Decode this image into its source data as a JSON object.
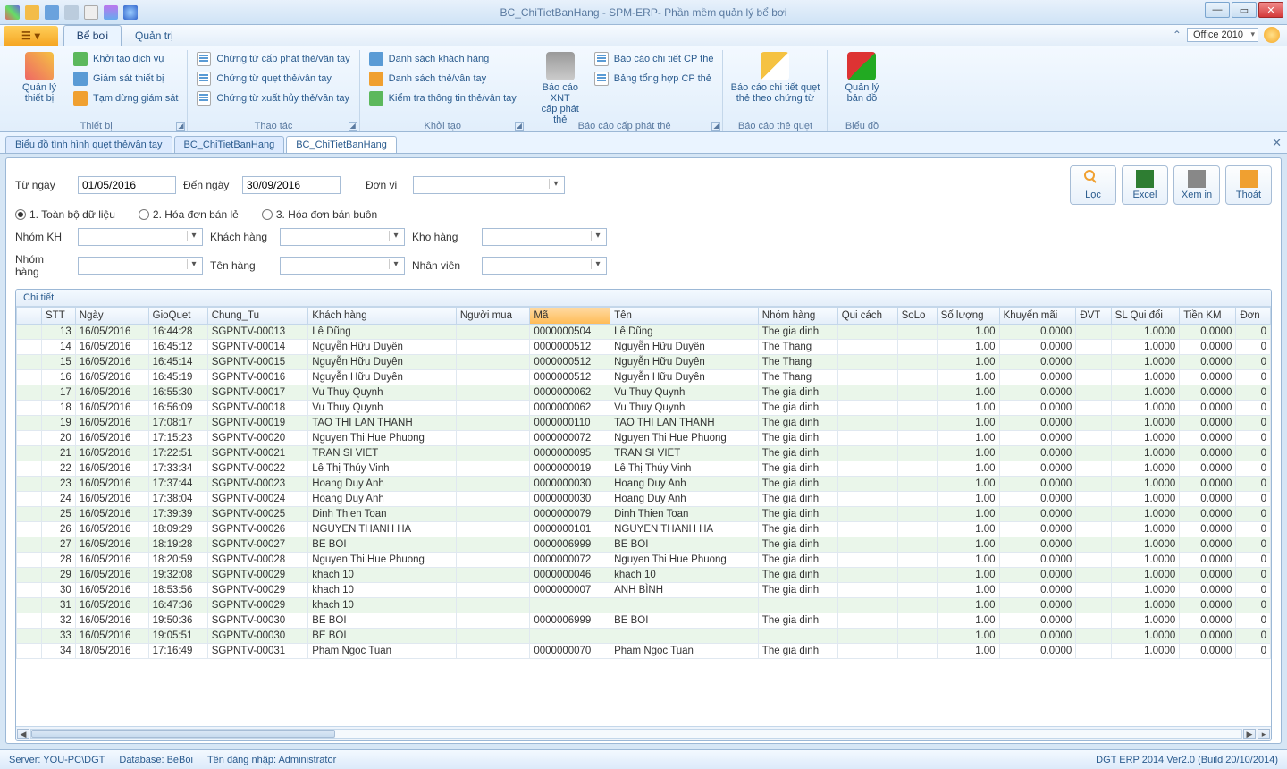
{
  "window": {
    "title": "BC_ChiTietBanHang - SPM-ERP- Phần mềm quản lý bể bơi"
  },
  "theme": "Office 2010",
  "ribbonTabs": {
    "file": "",
    "t1": "Bể bơi",
    "t2": "Quản trị"
  },
  "ribbon": {
    "g1": {
      "label": "Thiết bị",
      "large": "Quản lý\nthiết bị",
      "a": "Khởi tạo dịch vụ",
      "b": "Giám sát thiết bị",
      "c": "Tạm dừng giám sát"
    },
    "g2": {
      "label": "Thao tác",
      "a": "Chứng từ cấp phát thẻ/vân tay",
      "b": "Chứng từ quẹt thẻ/vân tay",
      "c": "Chứng từ xuất hủy thẻ/vân tay"
    },
    "g3": {
      "label": "Khởi tạo",
      "a": "Danh sách khách hàng",
      "b": "Danh sách thẻ/vân tay",
      "c": "Kiểm tra thông tin thẻ/vân tay"
    },
    "g4": {
      "label": "Báo cáo cấp phát thẻ",
      "large": "Báo cáo XNT\ncấp phát thẻ",
      "a": "Báo cáo chi tiết CP thẻ",
      "b": "Bảng tổng hợp CP thẻ"
    },
    "g5": {
      "label": "Báo cáo thẻ quẹt",
      "large": "Báo cáo chi tiết quẹt\nthẻ theo chứng từ"
    },
    "g6": {
      "label": "Biểu đồ",
      "large": "Quản lý\nbản đồ"
    }
  },
  "subtabs": {
    "a": "Biểu đồ tình hình quẹt thẻ/vân tay",
    "b": "BC_ChiTietBanHang",
    "c": "BC_ChiTietBanHang"
  },
  "filters": {
    "fromLabel": "Từ ngày",
    "from": "01/05/2016",
    "toLabel": "Đến ngày",
    "to": "30/09/2016",
    "donviLabel": "Đơn vị",
    "donvi": "",
    "r1": "1. Toàn bộ dữ liệu",
    "r2": "2. Hóa đơn bán lẻ",
    "r3": "3. Hóa đơn bán buôn",
    "nhomKHL": "Nhóm KH",
    "khachHangL": "Khách hàng",
    "khoHangL": "Kho hàng",
    "nhomHangL": "Nhóm hàng",
    "tenHangL": "Tên hàng",
    "nhanVienL": "Nhân viên"
  },
  "actions": {
    "loc": "Lọc",
    "excel": "Excel",
    "xemin": "Xem in",
    "thoat": "Thoát"
  },
  "grid": {
    "title": "Chi tiết",
    "cols": [
      "",
      "STT",
      "Ngày",
      "GioQuet",
      "Chung_Tu",
      "Khách hàng",
      "Người mua",
      "Mã",
      "Tên",
      "Nhóm hàng",
      "Qui cách",
      "SoLo",
      "Số lượng",
      "Khuyến mãi",
      "ĐVT",
      "SL Qui đổi",
      "Tiền KM",
      "Đơn"
    ],
    "rows": [
      {
        "stt": 13,
        "ngay": "16/05/2016",
        "gio": "16:44:28",
        "ct": "SGPNTV-00013",
        "kh": "Lê Dũng",
        "ma": "0000000504",
        "ten": "Lê Dũng",
        "nh": "The gia dinh"
      },
      {
        "stt": 14,
        "ngay": "16/05/2016",
        "gio": "16:45:12",
        "ct": "SGPNTV-00014",
        "kh": "Nguyễn Hữu Duyên",
        "ma": "0000000512",
        "ten": "Nguyễn Hữu Duyên",
        "nh": "The Thang"
      },
      {
        "stt": 15,
        "ngay": "16/05/2016",
        "gio": "16:45:14",
        "ct": "SGPNTV-00015",
        "kh": "Nguyễn Hữu Duyên",
        "ma": "0000000512",
        "ten": "Nguyễn Hữu Duyên",
        "nh": "The Thang"
      },
      {
        "stt": 16,
        "ngay": "16/05/2016",
        "gio": "16:45:19",
        "ct": "SGPNTV-00016",
        "kh": "Nguyễn Hữu Duyên",
        "ma": "0000000512",
        "ten": "Nguyễn Hữu Duyên",
        "nh": "The Thang"
      },
      {
        "stt": 17,
        "ngay": "16/05/2016",
        "gio": "16:55:30",
        "ct": "SGPNTV-00017",
        "kh": "Vu Thuy Quynh",
        "ma": "0000000062",
        "ten": "Vu Thuy Quynh",
        "nh": "The gia dinh"
      },
      {
        "stt": 18,
        "ngay": "16/05/2016",
        "gio": "16:56:09",
        "ct": "SGPNTV-00018",
        "kh": "Vu Thuy Quynh",
        "ma": "0000000062",
        "ten": "Vu Thuy Quynh",
        "nh": "The gia dinh"
      },
      {
        "stt": 19,
        "ngay": "16/05/2016",
        "gio": "17:08:17",
        "ct": "SGPNTV-00019",
        "kh": "TAO THI LAN THANH",
        "ma": "0000000110",
        "ten": "TAO THI LAN THANH",
        "nh": "The gia dinh"
      },
      {
        "stt": 20,
        "ngay": "16/05/2016",
        "gio": "17:15:23",
        "ct": "SGPNTV-00020",
        "kh": "Nguyen Thi Hue Phuong",
        "ma": "0000000072",
        "ten": "Nguyen Thi Hue Phuong",
        "nh": "The gia dinh"
      },
      {
        "stt": 21,
        "ngay": "16/05/2016",
        "gio": "17:22:51",
        "ct": "SGPNTV-00021",
        "kh": "TRAN SI VIET",
        "ma": "0000000095",
        "ten": "TRAN SI VIET",
        "nh": "The gia dinh"
      },
      {
        "stt": 22,
        "ngay": "16/05/2016",
        "gio": "17:33:34",
        "ct": "SGPNTV-00022",
        "kh": "Lê Thị Thúy Vinh",
        "ma": "0000000019",
        "ten": "Lê Thị Thúy Vinh",
        "nh": "The gia dinh"
      },
      {
        "stt": 23,
        "ngay": "16/05/2016",
        "gio": "17:37:44",
        "ct": "SGPNTV-00023",
        "kh": "Hoang Duy Anh",
        "ma": "0000000030",
        "ten": "Hoang Duy Anh",
        "nh": "The gia dinh"
      },
      {
        "stt": 24,
        "ngay": "16/05/2016",
        "gio": "17:38:04",
        "ct": "SGPNTV-00024",
        "kh": "Hoang Duy Anh",
        "ma": "0000000030",
        "ten": "Hoang Duy Anh",
        "nh": "The gia dinh"
      },
      {
        "stt": 25,
        "ngay": "16/05/2016",
        "gio": "17:39:39",
        "ct": "SGPNTV-00025",
        "kh": "Dinh Thien Toan",
        "ma": "0000000079",
        "ten": "Dinh Thien Toan",
        "nh": "The gia dinh"
      },
      {
        "stt": 26,
        "ngay": "16/05/2016",
        "gio": "18:09:29",
        "ct": "SGPNTV-00026",
        "kh": "NGUYEN THANH HA",
        "ma": "0000000101",
        "ten": "NGUYEN THANH HA",
        "nh": "The gia dinh"
      },
      {
        "stt": 27,
        "ngay": "16/05/2016",
        "gio": "18:19:28",
        "ct": "SGPNTV-00027",
        "kh": "BE BOI",
        "ma": "0000006999",
        "ten": "BE BOI",
        "nh": "The gia dinh"
      },
      {
        "stt": 28,
        "ngay": "16/05/2016",
        "gio": "18:20:59",
        "ct": "SGPNTV-00028",
        "kh": "Nguyen Thi Hue Phuong",
        "ma": "0000000072",
        "ten": "Nguyen Thi Hue Phuong",
        "nh": "The gia dinh"
      },
      {
        "stt": 29,
        "ngay": "16/05/2016",
        "gio": "19:32:08",
        "ct": "SGPNTV-00029",
        "kh": "khach 10",
        "ma": "0000000046",
        "ten": "khach 10",
        "nh": "The gia dinh"
      },
      {
        "stt": 30,
        "ngay": "16/05/2016",
        "gio": "18:53:56",
        "ct": "SGPNTV-00029",
        "kh": "khach 10",
        "ma": "0000000007",
        "ten": "ANH BÌNH",
        "nh": "The gia dinh"
      },
      {
        "stt": 31,
        "ngay": "16/05/2016",
        "gio": "16:47:36",
        "ct": "SGPNTV-00029",
        "kh": "khach 10",
        "ma": "",
        "ten": "",
        "nh": ""
      },
      {
        "stt": 32,
        "ngay": "16/05/2016",
        "gio": "19:50:36",
        "ct": "SGPNTV-00030",
        "kh": "BE BOI",
        "ma": "0000006999",
        "ten": "BE BOI",
        "nh": "The gia dinh"
      },
      {
        "stt": 33,
        "ngay": "16/05/2016",
        "gio": "19:05:51",
        "ct": "SGPNTV-00030",
        "kh": "BE BOI",
        "ma": "",
        "ten": "",
        "nh": ""
      },
      {
        "stt": 34,
        "ngay": "18/05/2016",
        "gio": "17:16:49",
        "ct": "SGPNTV-00031",
        "kh": "Pham Ngoc Tuan",
        "ma": "0000000070",
        "ten": "Pham Ngoc Tuan",
        "nh": "The gia dinh"
      }
    ],
    "num": {
      "sl": "1.00",
      "km": "0.0000",
      "qd": "1.0000",
      "tkm": "0.0000",
      "don": "0"
    }
  },
  "status": {
    "server": "Server: YOU-PC\\DGT",
    "db": "Database: BeBoi",
    "user": "Tên đăng nhập: Administrator",
    "ver": "DGT ERP 2014 Ver2.0 (Build 20/10/2014)"
  }
}
